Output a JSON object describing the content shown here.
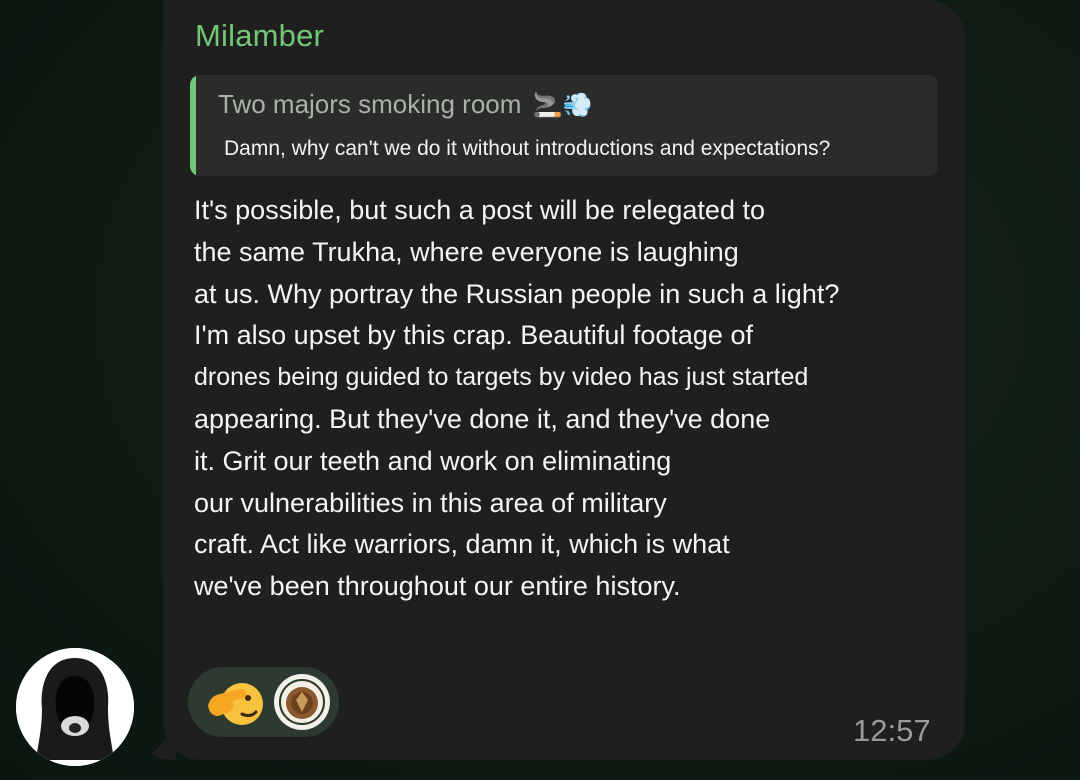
{
  "message": {
    "sender": "Milamber",
    "reply": {
      "title": "Two majors smoking room",
      "title_emoji": "🚬💨",
      "text": "Damn, why can't we do it without introductions and expectations?"
    },
    "lines": [
      "It's possible, but such a post will be relegated to",
      "the same Trukha, where everyone is laughing",
      "at us. Why portray the Russian people in such a light?",
      "I'm also upset by this crap. Beautiful footage of",
      "drones being guided to targets by video has just started",
      "appearing. But they've done it, and they've done",
      "it. Grit our teeth and work on eliminating",
      "our vulnerabilities in this area of military",
      "craft. Act like warriors, damn it, which is what",
      "we've been throughout our entire history."
    ],
    "time": "12:57"
  },
  "reactions": {
    "emoji": "saluting-face",
    "reactor": "avatar"
  },
  "colors": {
    "sender_name": "#72c776",
    "bubble": "#1f1f1f",
    "reply_bg": "#2a2c2a",
    "reaction_bg": "#2d3a2f",
    "background": "#0f1d14"
  }
}
